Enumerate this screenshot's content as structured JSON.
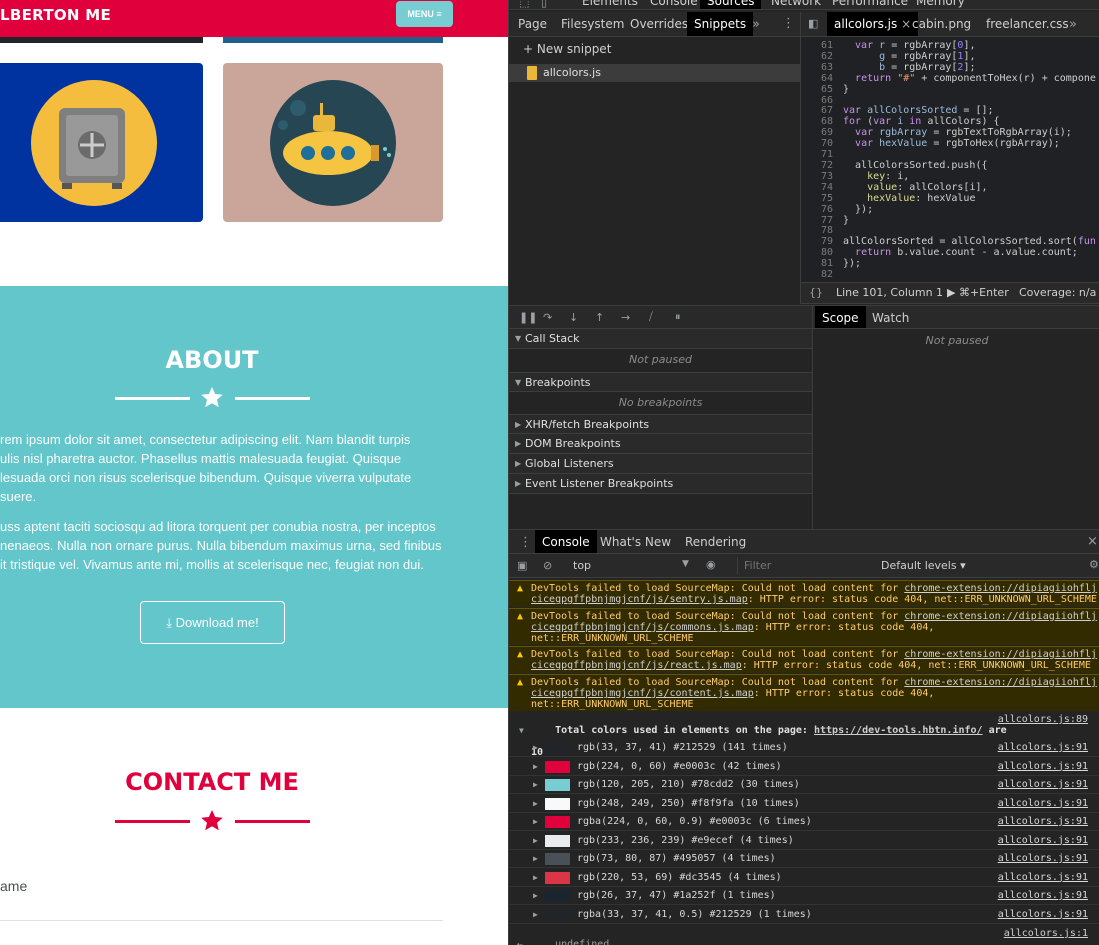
{
  "page": {
    "brand": "LBERTON ME",
    "menu_label": "MENU ≡",
    "about": {
      "title": "ABOUT",
      "paragraph1_lines": [
        "rem ipsum dolor sit amet, consectetur adipiscing elit. Nam blandit turpis",
        "ulis nisl pharetra auctor. Phasellus mattis malesuada feugiat. Quisque",
        "lesuada orci non risus scelerisque bibendum. Quisque viverra vulputate",
        "suere."
      ],
      "paragraph2_lines": [
        "uss aptent taciti sociosqu ad litora torquent per conubia nostra, per inceptos",
        "nenaeos. Nulla non ornare purus. Nulla bibendum maximus urna, sed finibus",
        "it tristique vel. Vivamus ante mi, mollis at scelerisque nec, feugiat non dui."
      ],
      "download_label": "Download me!"
    },
    "contact": {
      "title": "CONTACT ME",
      "name_label": "ame"
    }
  },
  "devtools": {
    "top_tabs": [
      "Elements",
      "Console",
      "Sources",
      "Network",
      "Performance",
      "Memory"
    ],
    "nav_tabs": [
      "Page",
      "Filesystem",
      "Overrides",
      "Snippets"
    ],
    "new_snippet": "New snippet",
    "snippet_file": "allcolors.js",
    "editor_tabs": [
      "allcolors.js",
      "cabin.png",
      "freelancer.css"
    ],
    "status": {
      "position": "Line 101, Column 1",
      "run": "⌘+Enter",
      "coverage": "Coverage: n/a"
    },
    "debugger": {
      "sections": [
        {
          "title": "Call Stack",
          "empty": "Not paused"
        },
        {
          "title": "Breakpoints",
          "empty": "No breakpoints"
        }
      ],
      "collapsed": [
        "XHR/fetch Breakpoints",
        "DOM Breakpoints",
        "Global Listeners",
        "Event Listener Breakpoints"
      ],
      "scope_tabs": [
        "Scope",
        "Watch"
      ],
      "scope_empty": "Not paused"
    },
    "drawer_tabs": [
      "Console",
      "What's New",
      "Rendering"
    ],
    "console_toolbar": {
      "context": "top",
      "filter_placeholder": "Filter",
      "levels": "Default levels"
    },
    "warnings": [
      {
        "pre": "DevTools failed to load SourceMap: Could not load content for ",
        "link": "chrome-extension://dipiagiiohflj",
        "line2_link": "cicegpgffpbnjmgjcnf/js/sentry.js.map",
        "line2_rest": ": HTTP error: status code 404, net::ERR_UNKNOWN_URL_SCHEME",
        "line3": ""
      },
      {
        "pre": "DevTools failed to load SourceMap: Could not load content for ",
        "link": "chrome-extension://dipiagiiohflj",
        "line2_link": "cicegpgffpbnjmgjcnf/js/commons.js.map",
        "line2_rest": ": HTTP error: status code 404,",
        "line3": "net::ERR_UNKNOWN_URL_SCHEME"
      },
      {
        "pre": "DevTools failed to load SourceMap: Could not load content for ",
        "link": "chrome-extension://dipiagiiohflj",
        "line2_link": "cicegpgffpbnjmgjcnf/js/react.js.map",
        "line2_rest": ": HTTP error: status code 404, net::ERR_UNKNOWN_URL_SCHEME",
        "line3": ""
      },
      {
        "pre": "DevTools failed to load SourceMap: Could not load content for ",
        "link": "chrome-extension://dipiagiiohflj",
        "line2_link": "cicegpgffpbnjmgjcnf/js/content.js.map",
        "line2_rest": ": HTTP error: status code 404,",
        "line3": "net::ERR_UNKNOWN_URL_SCHEME"
      }
    ],
    "total": {
      "text": "Total colors used in elements on the page: ",
      "link": "https://dev-tools.hbtn.info/",
      "after": " are",
      "line2": "10",
      "src": "allcolors.js:89"
    },
    "colors": [
      {
        "text": "rgb(33, 37, 41) #212529 (141 times)",
        "hex": "#212529"
      },
      {
        "text": "rgb(224, 0, 60) #e0003c (42 times)",
        "hex": "#e0003c"
      },
      {
        "text": "rgb(120, 205, 210) #78cdd2 (30 times)",
        "hex": "#78cdd2"
      },
      {
        "text": "rgb(248, 249, 250) #f8f9fa (10 times)",
        "hex": "#f8f9fa"
      },
      {
        "text": "rgba(224, 0, 60, 0.9) #e0003c (6 times)",
        "hex": "#e0003c"
      },
      {
        "text": "rgb(233, 236, 239) #e9ecef (4 times)",
        "hex": "#e9ecef"
      },
      {
        "text": "rgb(73, 80, 87) #495057 (4 times)",
        "hex": "#495057"
      },
      {
        "text": "rgb(220, 53, 69) #dc3545 (4 times)",
        "hex": "#dc3545"
      },
      {
        "text": "rgb(26, 37, 47) #1a252f (1 times)",
        "hex": "#1a252f"
      },
      {
        "text": "rgba(33, 37, 41, 0.5) #212529 (1 times)",
        "hex": "#212529"
      }
    ],
    "color_src": "allcolors.js:91",
    "result": "undefined",
    "result_src": "allcolors.js:1"
  }
}
